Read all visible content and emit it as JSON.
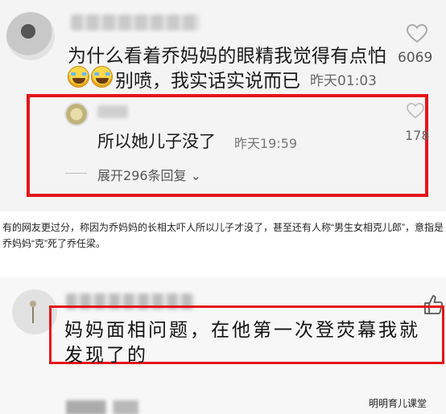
{
  "top_comment": {
    "text": "为什么看着乔妈妈的眼精我觉得有点怕",
    "line2": "别喷，我实话实说而已",
    "time": "昨天01:03",
    "likes": "6069",
    "icons": [
      "avatar",
      "heart-icon",
      "laughing-emoji",
      "laughing-emoji"
    ]
  },
  "reply": {
    "text": "所以她儿子没了",
    "time": "昨天19:59",
    "likes": "178",
    "expand": "展开296条回复",
    "border_color": "#e4151a"
  },
  "caption": "有的网友更过分，称因为乔妈妈的长相太吓人所以儿子才没了，甚至还有人称“男生女相克儿郎”，意指是乔妈妈“克”死了乔任梁。",
  "bottom_comment": {
    "line1": "妈妈面相问题，在他第一次登荧幕我就",
    "line2": "发现了的",
    "icons": [
      "avatar",
      "thumbs-up-icon"
    ],
    "border_color": "#e4151a"
  },
  "watermark": "明明育儿课堂"
}
